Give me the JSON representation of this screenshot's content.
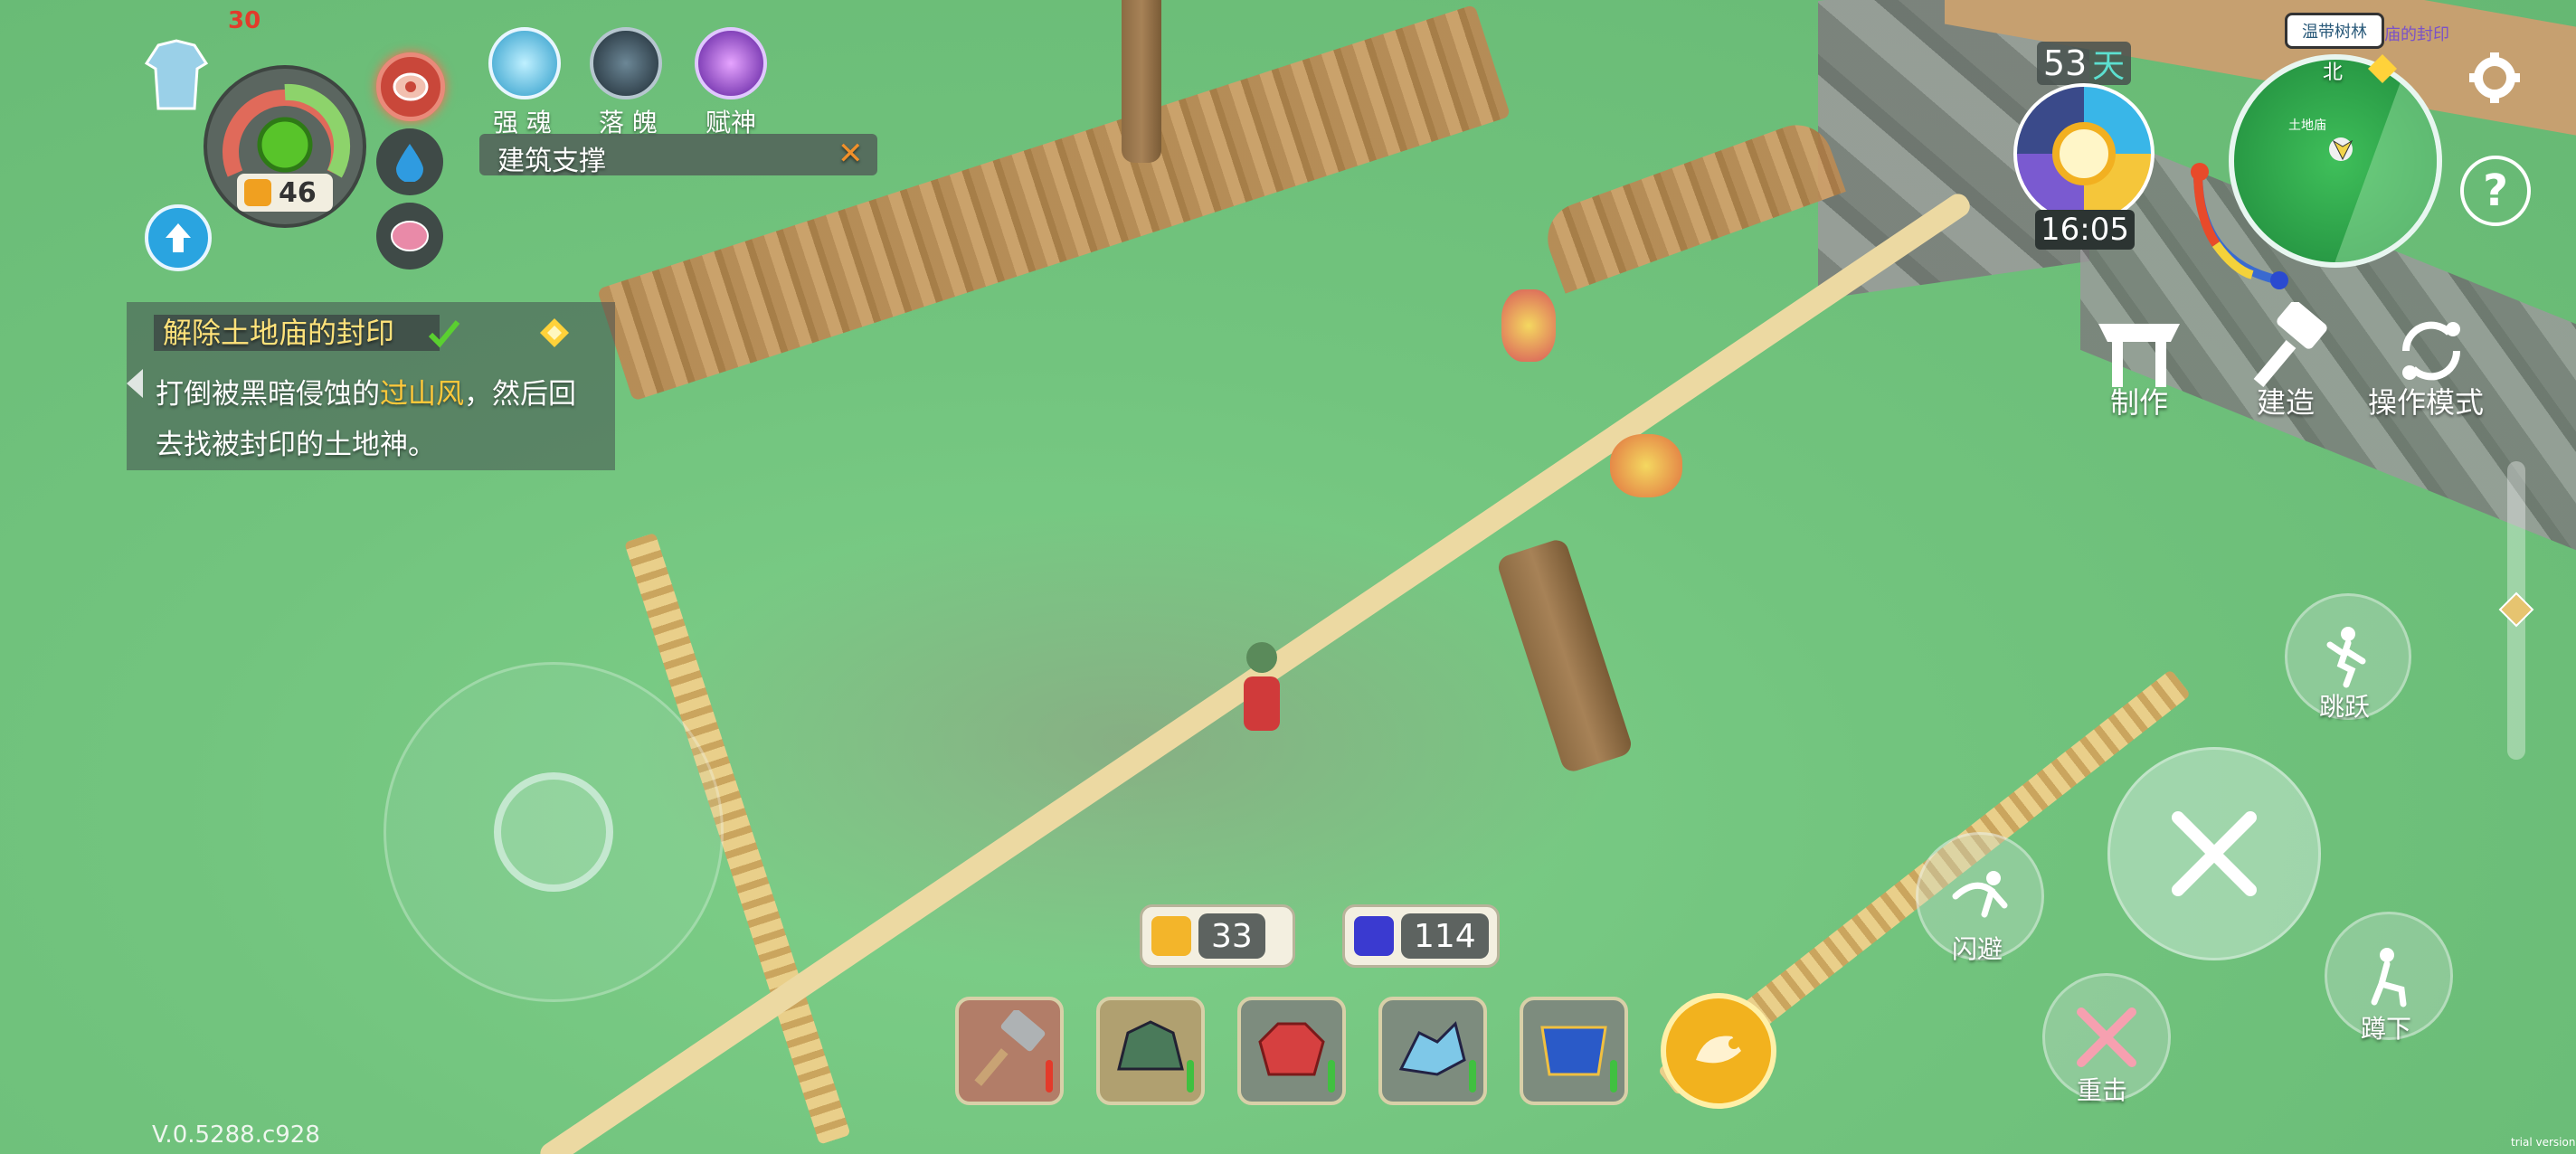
{
  "status": {
    "level": "30",
    "hunger_value": "46"
  },
  "skills": [
    {
      "label": "强 魂",
      "icon": "soul-strengthen-icon"
    },
    {
      "label": "落 魄",
      "icon": "soul-fall-icon"
    },
    {
      "label": "赋神",
      "icon": "empower-icon"
    }
  ],
  "building_support": {
    "label": "建筑支撑",
    "close": "✕"
  },
  "quest": {
    "title": "解除土地庙的封印",
    "desc_before": "打倒被黑暗侵蚀的",
    "desc_highlight": "过山风",
    "desc_after": "，然后回去找被封印的土地神。"
  },
  "clock": {
    "day": "53",
    "day_unit": "天",
    "time": "16:05"
  },
  "minimap": {
    "region": "温带树林",
    "direction": "北",
    "small_label": "土地庙",
    "quest_hint": "庙的封印"
  },
  "actions": {
    "craft": "制作",
    "build": "建造",
    "mode": "操作模式",
    "jump": "跳跃",
    "dodge": "闪避",
    "crouch": "蹲下",
    "heavy": "重击"
  },
  "resources": [
    {
      "icon": "hammer-resource-icon",
      "value": "33"
    },
    {
      "icon": "armor-resource-icon",
      "value": "114"
    }
  ],
  "hotbar": [
    {
      "name": "hammer-item-icon"
    },
    {
      "name": "dragon-helmet-item-icon"
    },
    {
      "name": "red-gem-item-icon"
    },
    {
      "name": "ice-beast-item-icon"
    },
    {
      "name": "blue-cloak-item-icon"
    },
    {
      "name": "meat-item-icon"
    }
  ],
  "version": "V.0.5288.c928",
  "trial": "trial version",
  "colors": {
    "quest_highlight": "#ffc83a",
    "quest_title": "#ffe27a",
    "health_green": "#58c42a",
    "panel_bg": "#46504f"
  }
}
